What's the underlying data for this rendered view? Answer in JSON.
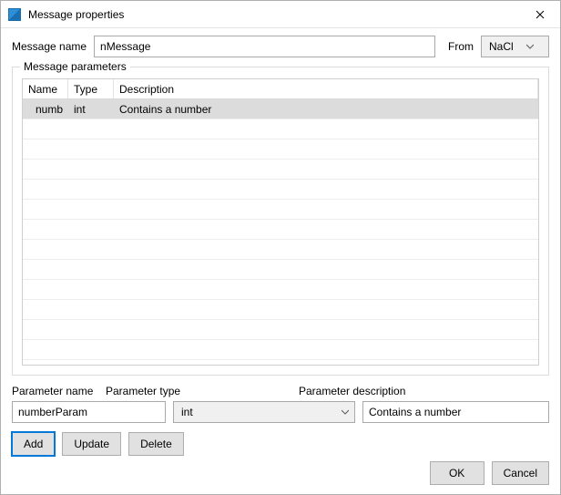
{
  "window": {
    "title": "Message properties"
  },
  "top": {
    "name_label": "Message name",
    "name_value": "nMessage",
    "from_label": "From",
    "from_value": "NaCl"
  },
  "group": {
    "legend": "Message parameters",
    "columns": {
      "name": "Name",
      "type": "Type",
      "desc": "Description"
    },
    "rows": [
      {
        "name": "numb",
        "type": "int",
        "desc": "Contains a number"
      }
    ]
  },
  "param": {
    "name_label": "Parameter name",
    "type_label": "Parameter type",
    "desc_label": "Parameter description",
    "name_value": "numberParam",
    "type_value": "int",
    "desc_value": "Contains a number"
  },
  "buttons": {
    "add": "Add",
    "update": "Update",
    "delete": "Delete",
    "ok": "OK",
    "cancel": "Cancel"
  }
}
